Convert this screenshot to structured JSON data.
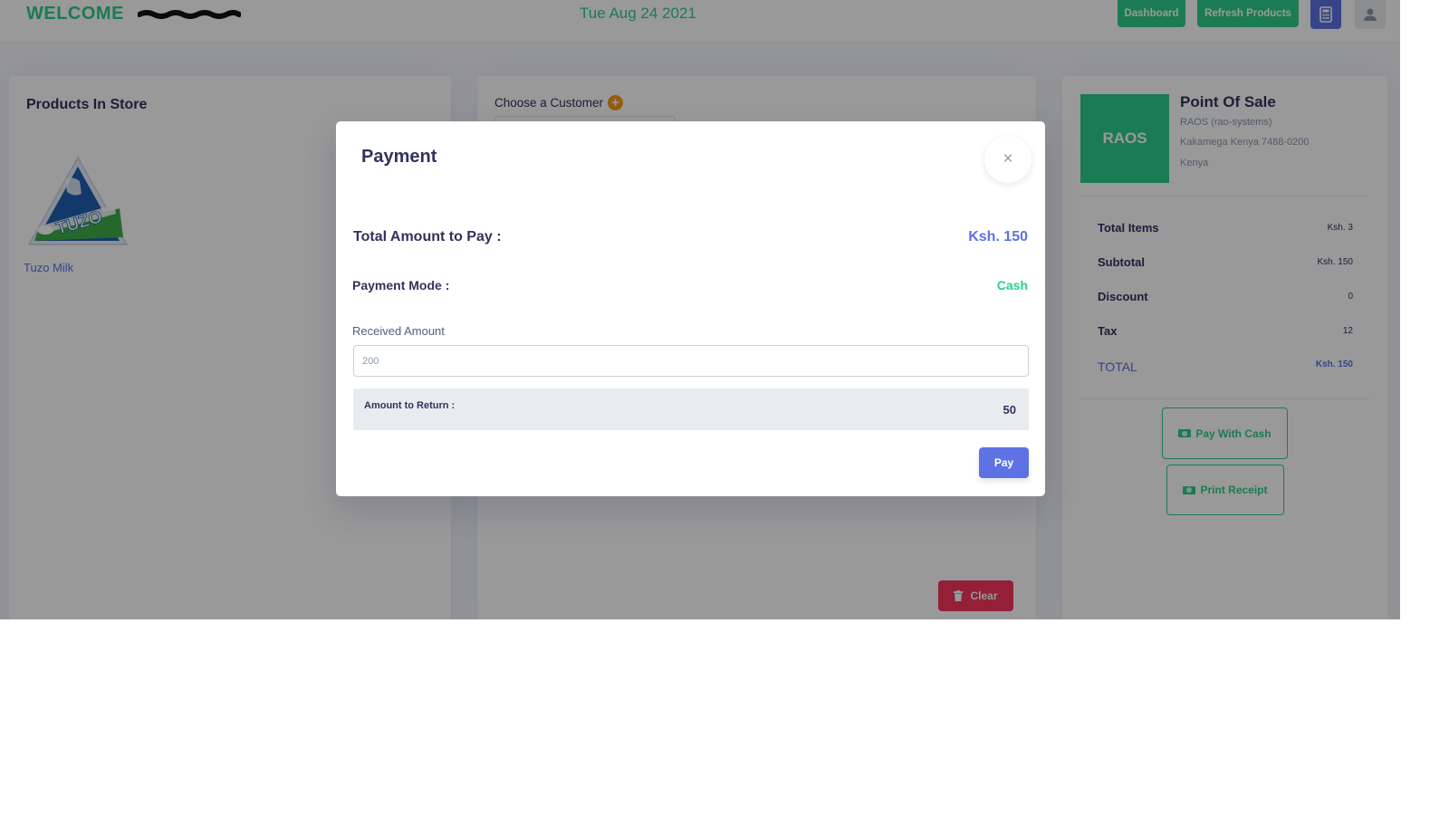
{
  "header": {
    "welcome": "WELCOME",
    "date": "Tue Aug 24 2021",
    "dashboard_label": "Dashboard",
    "refresh_label": "Refresh Products",
    "calculator_icon": "calculator-icon",
    "user_icon": "user-icon"
  },
  "products": {
    "title": "Products In Store",
    "items": [
      {
        "name": "Tuzo Milk",
        "image_icon": "milk-pack-image"
      }
    ]
  },
  "cart": {
    "choose_customer_label": "Choose a Customer",
    "add_icon_glyph": "+",
    "clear_label": "Clear"
  },
  "summary": {
    "logo_text": "RAOS",
    "pos_title": "Point Of Sale",
    "company": "RAOS (rao-systems)",
    "address": "Kakamega Kenya 7488-0200",
    "country": "Kenya",
    "rows": [
      {
        "label": "Total Items",
        "value": "Ksh. 3"
      },
      {
        "label": "Subtotal",
        "value": "Ksh. 150"
      },
      {
        "label": "Discount",
        "value": "0"
      },
      {
        "label": "Tax",
        "value": "12"
      },
      {
        "label": "TOTAL",
        "value": "Ksh. 150"
      }
    ],
    "pay_cash_label": "Pay With Cash",
    "print_receipt_label": "Print Receipt"
  },
  "modal": {
    "title": "Payment",
    "close_glyph": "×",
    "total_label": "Total Amount to Pay :",
    "total_value": "Ksh. 150",
    "mode_label": "Payment Mode :",
    "mode_value": "Cash",
    "received_label": "Received Amount",
    "received_value": "200",
    "return_label": "Amount to Return :",
    "return_value": "50",
    "pay_label": "Pay"
  },
  "colors": {
    "primary": "#5e72e4",
    "success": "#2dce89",
    "danger": "#f5365c",
    "warning": "#fb9a1f",
    "text_dark": "#32325d"
  }
}
